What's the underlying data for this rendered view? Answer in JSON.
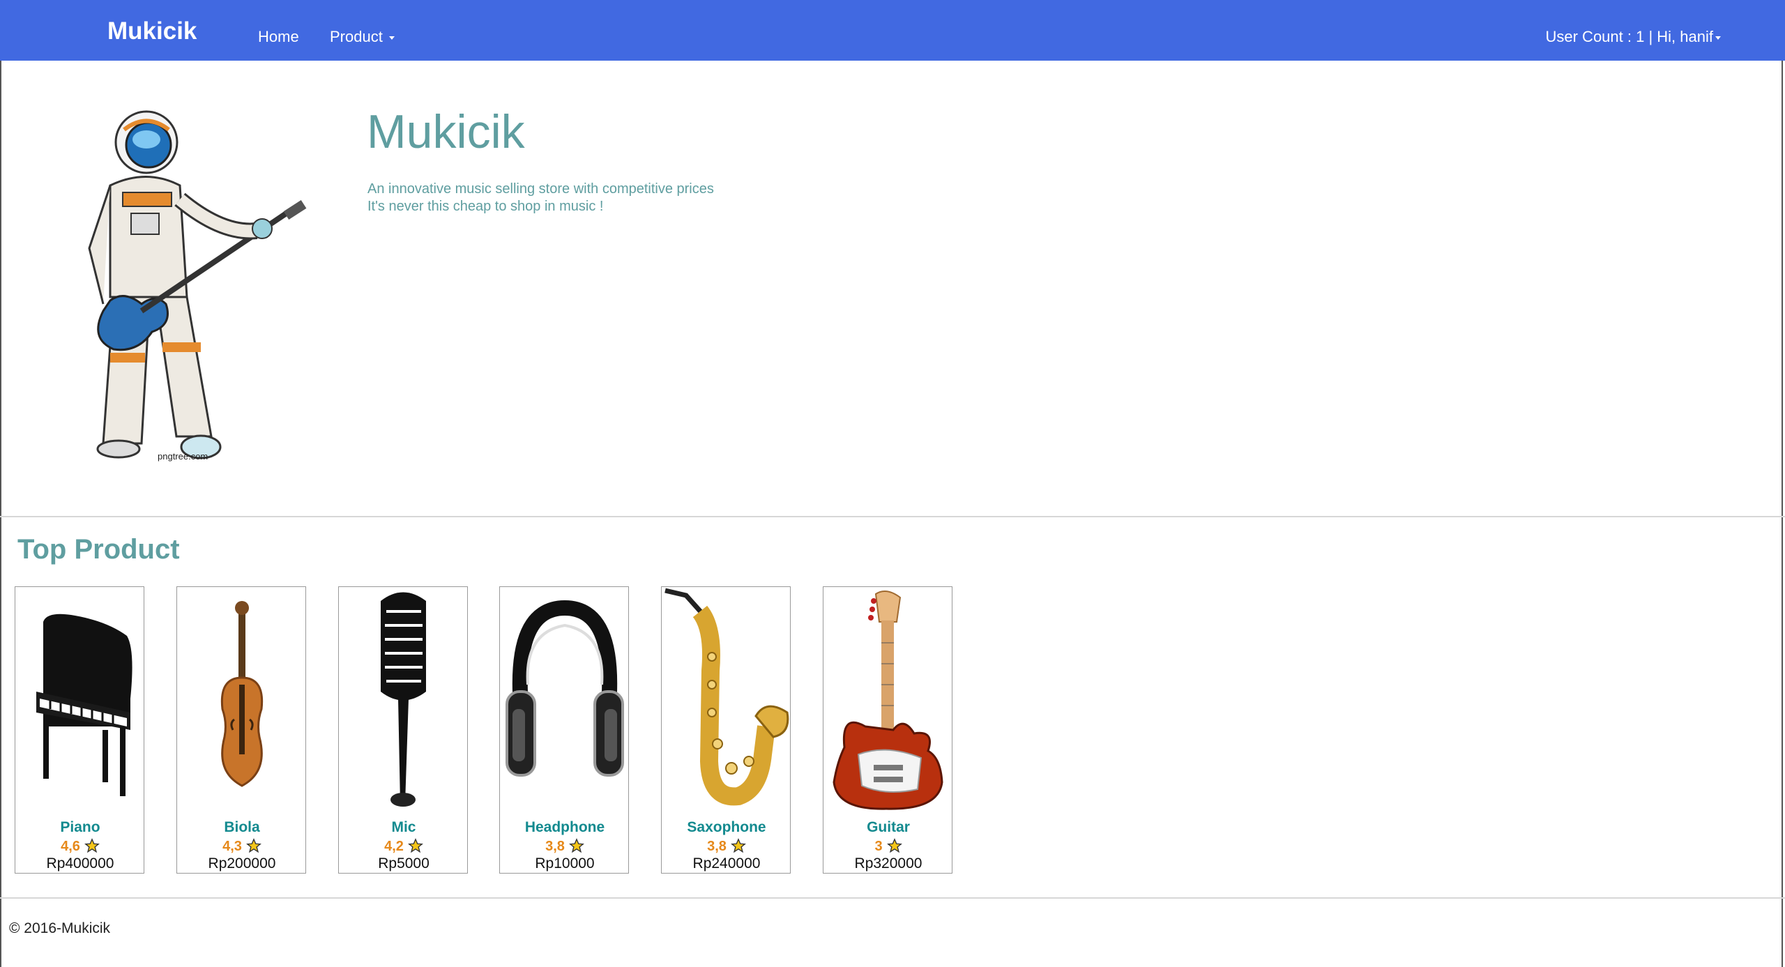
{
  "navbar": {
    "brand": "Mukicik",
    "home_label": "Home",
    "product_label": "Product",
    "user_count_text": "User Count : 1 | ",
    "user_greeting": "Hi, hanif",
    "color": "#4169e1"
  },
  "hero": {
    "title": "Mukicik",
    "line1": "An innovative music selling store with competitive prices",
    "line2": "It's never this cheap to shop in music !",
    "image_watermark": "pngtree.com",
    "image_icon": "astronaut-guitar"
  },
  "top_product": {
    "heading": "Top Product",
    "items": [
      {
        "name": "Piano",
        "rating": "4,6",
        "price": "Rp400000",
        "icon": "piano"
      },
      {
        "name": "Biola",
        "rating": "4,3",
        "price": "Rp200000",
        "icon": "violin"
      },
      {
        "name": "Mic",
        "rating": "4,2",
        "price": "Rp5000",
        "icon": "microphone"
      },
      {
        "name": "Headphone",
        "rating": "3,8",
        "price": "Rp10000",
        "icon": "headphone"
      },
      {
        "name": "Saxophone",
        "rating": "3,8",
        "price": "Rp240000",
        "icon": "saxophone"
      },
      {
        "name": "Guitar",
        "rating": "3",
        "price": "Rp320000",
        "icon": "guitar"
      }
    ]
  },
  "footer": {
    "copyright": "© 2016-Mukicik"
  }
}
